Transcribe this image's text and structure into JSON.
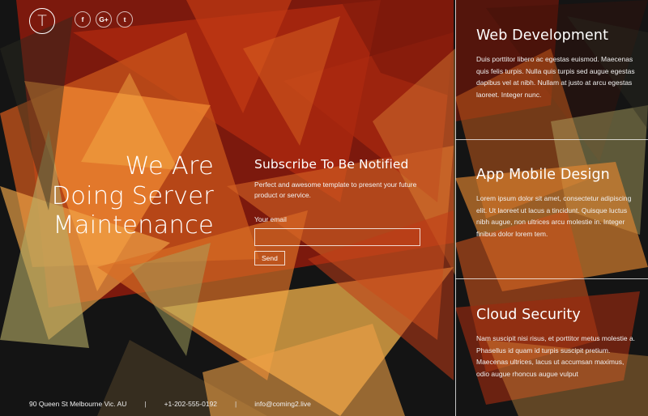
{
  "brand": {
    "logo_letter": "T"
  },
  "socials": [
    {
      "label": "f",
      "icon": "facebook-icon"
    },
    {
      "label": "G+",
      "icon": "google-plus-icon"
    },
    {
      "label": "t",
      "icon": "twitter-icon"
    }
  ],
  "hero": {
    "lines": [
      "We Are",
      "Doing Server",
      "Maintenance"
    ]
  },
  "subscribe": {
    "title": "Subscribe To Be Notified",
    "description": "Perfect and awesome template to present your future product or service.",
    "email_label": "Your email",
    "email_value": "",
    "send_label": "Send"
  },
  "services": [
    {
      "title": "Web Development",
      "text": "Duis porttitor libero ac egestas euismod. Maecenas quis felis turpis. Nulla quis turpis sed augue egestas dapibus vel at nibh. Nullam at justo at arcu egestas laoreet. Integer nunc."
    },
    {
      "title": "App Mobile Design",
      "text": "Lorem ipsum dolor sit amet, consectetur adipiscing elit. Ut laoreet ut lacus a tincidunt. Quisque luctus nibh augue, non ultrices arcu molestie in. Integer finibus dolor lorem tem."
    },
    {
      "title": "Cloud Security",
      "text": "Nam suscipit nisi risus, et porttitor metus molestie a. Phasellus id quam id turpis suscipit pretium. Maecenas ultrices, lacus ut accumsan maximus, odio augue rhoncus augue vulput"
    }
  ],
  "footer": {
    "address": "90 Queen St Melbourne Vic. AU",
    "phone": "+1-202-555-0192",
    "email": "info@coming2.live"
  },
  "colors": {
    "background": "#141414",
    "accent_dark_red": "#a5200e",
    "accent_orange": "#e8762a",
    "accent_yellow": "#f2b04a",
    "accent_olive": "#b9b06a"
  }
}
